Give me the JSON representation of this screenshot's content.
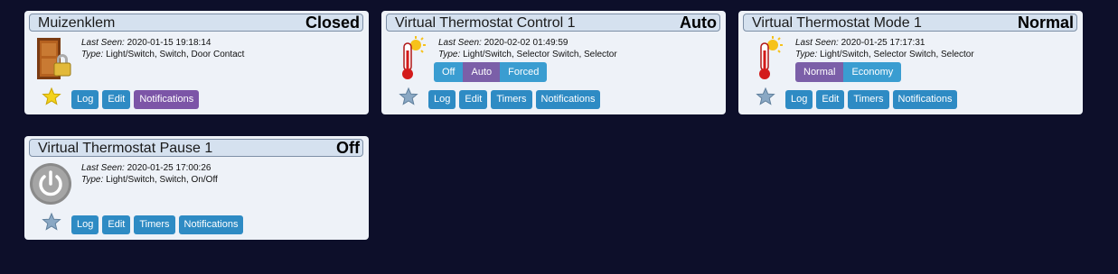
{
  "labels": {
    "last_seen": "Last Seen:",
    "type": "Type:"
  },
  "cards": [
    {
      "title": "Muizenklem",
      "status": "Closed",
      "icon": "door-lock-icon",
      "favorite": true,
      "last_seen": "2020-01-15 19:18:14",
      "type": "Light/Switch, Switch, Door Contact",
      "buttons": [
        "Log",
        "Edit",
        "Notifications"
      ]
    },
    {
      "title": "Virtual Thermostat Control 1",
      "status": "Auto",
      "icon": "thermometer-icon",
      "favorite": false,
      "last_seen": "2020-02-02 01:49:59",
      "type": "Light/Switch, Selector Switch, Selector",
      "selector": [
        "Off",
        "Auto",
        "Forced"
      ],
      "selected": "Auto",
      "buttons": [
        "Log",
        "Edit",
        "Timers",
        "Notifications"
      ]
    },
    {
      "title": "Virtual Thermostat Mode 1",
      "status": "Normal",
      "icon": "thermometer-icon",
      "favorite": false,
      "last_seen": "2020-01-25 17:17:31",
      "type": "Light/Switch, Selector Switch, Selector",
      "selector": [
        "Normal",
        "Economy"
      ],
      "selected": "Normal",
      "buttons": [
        "Log",
        "Edit",
        "Timers",
        "Notifications"
      ]
    },
    {
      "title": "Virtual Thermostat Pause 1",
      "status": "Off",
      "icon": "power-button-icon",
      "favorite": false,
      "last_seen": "2020-01-25 17:00:26",
      "type": "Light/Switch, Switch, On/Off",
      "buttons": [
        "Log",
        "Edit",
        "Timers",
        "Notifications"
      ]
    }
  ],
  "colors": {
    "background": "#0d0f2a",
    "card": "#eef2f8",
    "button_blue": "#2e8bc4",
    "button_purple": "#7c55a7",
    "selector_blue": "#3a9dd1",
    "selector_active": "#7b5fa8"
  }
}
